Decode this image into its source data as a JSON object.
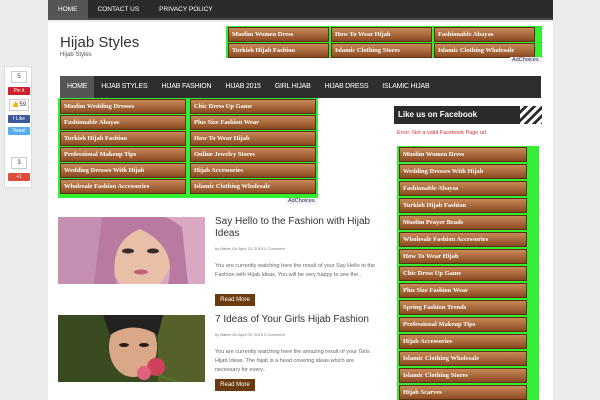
{
  "topnav": [
    "HOME",
    "CONTACT US",
    "PRIVACY POLICY"
  ],
  "site": {
    "title": "Hijab Styles",
    "subtitle": "Hijab Styles"
  },
  "header_ads": [
    "Muslim Women Dress",
    "How To Wear Hijab",
    "Fashionable Abayas",
    "Turkish Hijab Fashion",
    "Islamic Clothing Stores",
    "Islamic Clothing Wholesale"
  ],
  "adchoices": "AdChoices",
  "mainnav": [
    "HOME",
    "HIJAB STYLES",
    "HIJAB FASHION",
    "HIJAB 2015",
    "GIRL HIJAB",
    "HIJAB DRESS",
    "ISLAMIC HIJAB"
  ],
  "content_ads": [
    "Muslim Wedding Dresses",
    "Chic Dress Up Game",
    "Fashionable Abayas",
    "Plus Size Fashion Wear",
    "Turkish Hijab Fashion",
    "How To Wear Hijab",
    "Professional Makeup Tips",
    "Online Jewelry Stores",
    "Wedding Dresses With Hijab",
    "Hijab Accessories",
    "Wholesale Fashion Accessories",
    "Islamic Clothing Wholesale"
  ],
  "posts": [
    {
      "title": "Say Hello to the Fashion with Hijab Ideas",
      "meta": "by Baber On April 13, 2015 0 Comment",
      "excerpt": "You are currently watching here the result of your Say Hello to the Fashion with Hijab Ideas. You will be very happy to see the..",
      "read_more": "Read More"
    },
    {
      "title": "7 Ideas of Your Girls Hijab Fashion",
      "meta": "by Baber On April 09, 2015 0 Comment",
      "excerpt": "You are currently watching here the amazing result of your Girls Hijab Ideas. The hijab is a head covering ideas which are necessary for every..",
      "read_more": "Read More"
    }
  ],
  "sidebar": {
    "heading": "Like us on Facebook",
    "error": "Error: Not a valid Facebook Page url.",
    "ads": [
      "Muslim Women Dress",
      "Wedding Dresses With Hijab",
      "Fashionable Abayas",
      "Turkish Hijab Fashion",
      "Muslim Prayer Beads",
      "Wholesale Fashion Accessories",
      "How To Wear Hijab",
      "Chic Dress Up Game",
      "Plus Size Fashion Wear",
      "Spring Fashion Trends",
      "Professional Makeup Tips",
      "Hijab Accessories",
      "Islamic Clothing Wholesale",
      "Islamic Clothing Stores",
      "Hijab Scarves"
    ]
  },
  "social": {
    "count1": "5",
    "pin": "Pin it",
    "likes": "59",
    "fb_like": "Like",
    "tweet": "Tweet",
    "count2": "3",
    "gplus": "+1"
  }
}
